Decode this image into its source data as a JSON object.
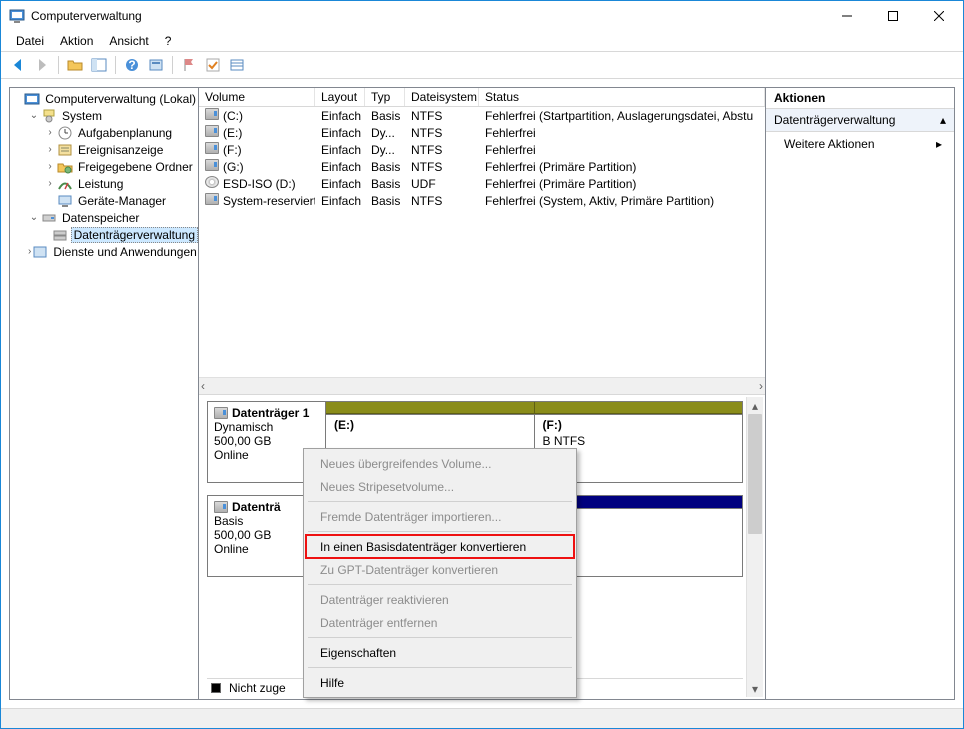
{
  "window": {
    "title": "Computerverwaltung"
  },
  "menubar": [
    "Datei",
    "Aktion",
    "Ansicht",
    "?"
  ],
  "tree": {
    "root": "Computerverwaltung (Lokal)",
    "system": "System",
    "aufgaben": "Aufgabenplanung",
    "ereignis": "Ereignisanzeige",
    "freigeg": "Freigegebene Ordner",
    "leistung": "Leistung",
    "geraete": "Geräte-Manager",
    "datenspeicher": "Datenspeicher",
    "dtv": "Datenträgerverwaltung",
    "dienste": "Dienste und Anwendungen"
  },
  "vol_headers": [
    "Volume",
    "Layout",
    "Typ",
    "Dateisystem",
    "Status"
  ],
  "volumes": [
    {
      "name": "(C:)",
      "layout": "Einfach",
      "typ": "Basis",
      "fs": "NTFS",
      "status": "Fehlerfrei (Startpartition, Auslagerungsdatei, Abstu",
      "icon": "drv"
    },
    {
      "name": "(E:)",
      "layout": "Einfach",
      "typ": "Dy...",
      "fs": "NTFS",
      "status": "Fehlerfrei",
      "icon": "drv"
    },
    {
      "name": "(F:)",
      "layout": "Einfach",
      "typ": "Dy...",
      "fs": "NTFS",
      "status": "Fehlerfrei",
      "icon": "drv"
    },
    {
      "name": "(G:)",
      "layout": "Einfach",
      "typ": "Basis",
      "fs": "NTFS",
      "status": "Fehlerfrei (Primäre Partition)",
      "icon": "drv"
    },
    {
      "name": "ESD-ISO (D:)",
      "layout": "Einfach",
      "typ": "Basis",
      "fs": "UDF",
      "status": "Fehlerfrei (Primäre Partition)",
      "icon": "cd"
    },
    {
      "name": "System-reserviert",
      "layout": "Einfach",
      "typ": "Basis",
      "fs": "NTFS",
      "status": "Fehlerfrei (System, Aktiv, Primäre Partition)",
      "icon": "drv"
    }
  ],
  "disks": {
    "d1": {
      "name": "Datenträger 1",
      "type": "Dynamisch",
      "size": "500,00 GB",
      "state": "Online",
      "parts": [
        {
          "label": "(E:)",
          "line2": "",
          "line3": ""
        },
        {
          "label": "(F:)",
          "line2": "B NTFS",
          "line3": "ei"
        }
      ]
    },
    "d2": {
      "name": "Datenträ",
      "type": "Basis",
      "size": "500,00 GB",
      "state": "Online"
    }
  },
  "legend": {
    "unalloc": "Nicht zuge"
  },
  "actions": {
    "title": "Aktionen",
    "section": "Datenträgerverwaltung",
    "more": "Weitere Aktionen"
  },
  "context_menu": [
    {
      "label": "Neues übergreifendes Volume...",
      "enabled": false
    },
    {
      "label": "Neues Stripesetvolume...",
      "enabled": false
    },
    {
      "sep": true
    },
    {
      "label": "Fremde Datenträger importieren...",
      "enabled": false
    },
    {
      "sep": true
    },
    {
      "label": "In einen Basisdatenträger konvertieren",
      "enabled": true,
      "highlight": true
    },
    {
      "label": "Zu GPT-Datenträger konvertieren",
      "enabled": false
    },
    {
      "sep": true
    },
    {
      "label": "Datenträger reaktivieren",
      "enabled": false
    },
    {
      "label": "Datenträger entfernen",
      "enabled": false
    },
    {
      "sep": true
    },
    {
      "label": "Eigenschaften",
      "enabled": true
    },
    {
      "sep": true
    },
    {
      "label": "Hilfe",
      "enabled": true
    }
  ]
}
